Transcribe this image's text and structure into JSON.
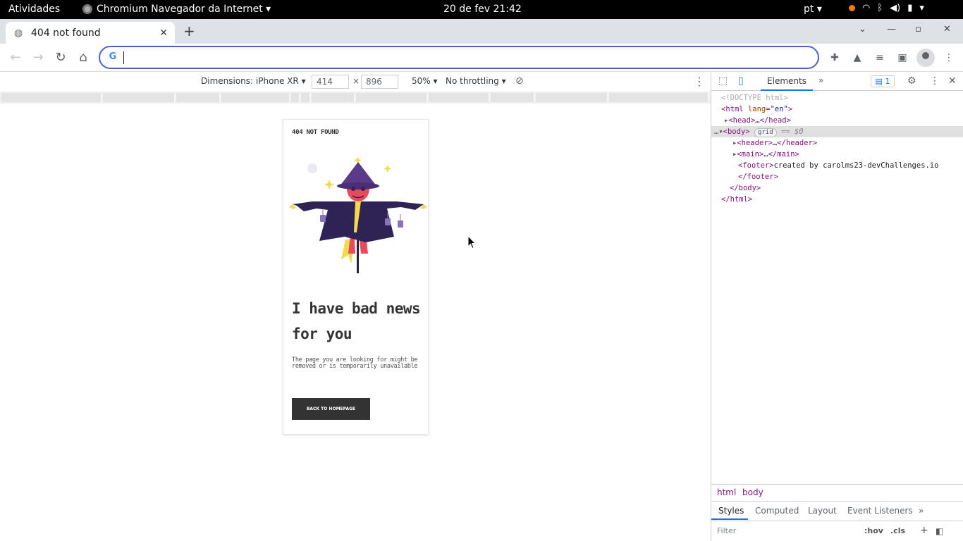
{
  "system": {
    "activities": "Atividades",
    "app_name": "Chromium Navegador da Internet ▾",
    "clock": "20 de fev  21:42",
    "language": "pt ▾"
  },
  "browser": {
    "tab_title": "404 not found",
    "tab_close": "✕",
    "new_tab": "+",
    "omnibox_value": ""
  },
  "device_toolbar": {
    "dimensions_label": "Dimensions: iPhone XR ▾",
    "width": "414",
    "height": "896",
    "times": "×",
    "zoom": "50% ▾",
    "throttling": "No throttling ▾"
  },
  "page": {
    "brand": "404 NOT FOUND",
    "heading": "I have bad news for you",
    "description": "The page you are looking for might be removed or is temporarily unavailable",
    "button": "BACK TO HOMEPAGE"
  },
  "devtools": {
    "tab_elements": "Elements",
    "issues_count": "1",
    "dom": {
      "doctype": "<!DOCTYPE html>",
      "html_open_tag": "html",
      "lang_attr": "lang",
      "lang_value": "\"en\"",
      "head": "head",
      "body": "body",
      "grid_badge": "grid",
      "dollar": "== $0",
      "header": "header",
      "main": "main",
      "footer": "footer",
      "footer_text": "created by carolms23-devChallenges.io"
    },
    "breadcrumbs": [
      "html",
      "body"
    ],
    "subtabs": [
      "Styles",
      "Computed",
      "Layout",
      "Event Listeners"
    ],
    "filter_placeholder": "Filter",
    "hov": ":hov",
    "cls": ".cls"
  }
}
